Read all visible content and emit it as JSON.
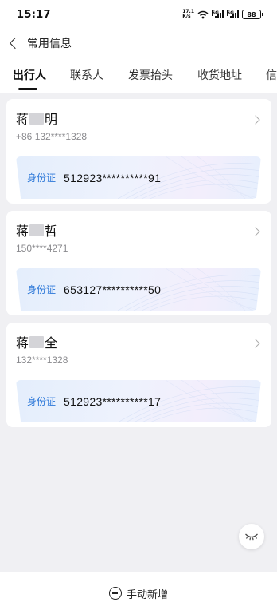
{
  "status_bar": {
    "time": "15:17",
    "speed_top": "17.1",
    "speed_bottom": "K/s",
    "network_1": "5G",
    "network_2": "5G",
    "battery": "88"
  },
  "header": {
    "title": "常用信息"
  },
  "tabs": [
    {
      "label": "出行人",
      "active": true
    },
    {
      "label": "联系人",
      "active": false
    },
    {
      "label": "发票抬头",
      "active": false
    },
    {
      "label": "收货地址",
      "active": false
    },
    {
      "label": "信",
      "active": false
    }
  ],
  "passengers": [
    {
      "name_first": "蒋",
      "name_last": "明",
      "phone": "+86 132****1328",
      "id_type": "身份证",
      "id_number": "512923**********91"
    },
    {
      "name_first": "蒋",
      "name_last": "哲",
      "phone": "150****4271",
      "id_type": "身份证",
      "id_number": "653127**********50"
    },
    {
      "name_first": "蒋",
      "name_last": "全",
      "phone": "132****1328",
      "id_type": "身份证",
      "id_number": "512923**********17"
    }
  ],
  "footer": {
    "add_label": "手动新增"
  },
  "colors": {
    "accent_blue": "#2b77d8",
    "background": "#f0f0f3"
  }
}
